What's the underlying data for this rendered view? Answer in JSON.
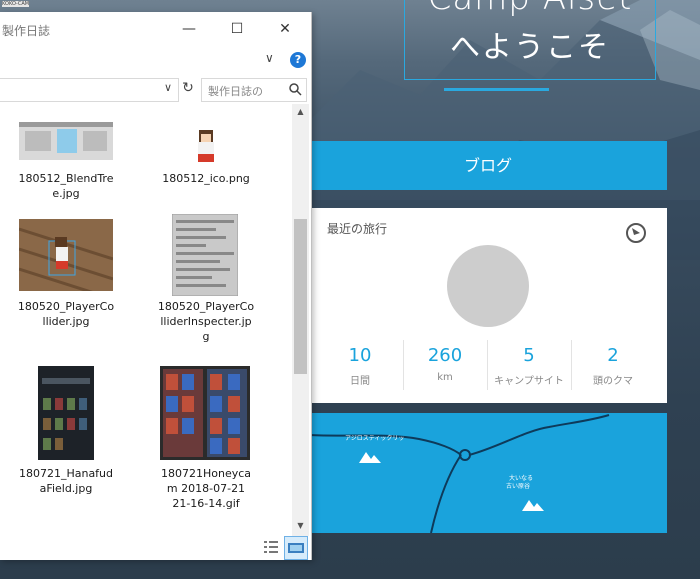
{
  "colors": {
    "accent": "#1aa3dc",
    "explorer_bg": "#ffffff",
    "hero_border": "#2aa9e0"
  },
  "corner_tag": "KOKO-CAM",
  "explorer": {
    "title": "製作日誌",
    "controls": {
      "minimize": "—",
      "maximize": "☐",
      "close": "✕"
    },
    "ribbon": {
      "chevron": "∨",
      "help": "?"
    },
    "address": {
      "dropdown": "∨",
      "refresh": "↻"
    },
    "search": {
      "placeholder": "製作日誌の"
    },
    "files": [
      {
        "name_line1": "180512_BlendTre",
        "name_line2": "e.jpg",
        "name_line3": ""
      },
      {
        "name_line1": "180512_ico.png",
        "name_line2": "",
        "name_line3": ""
      },
      {
        "name_line1": "180520_PlayerCo",
        "name_line2": "llider.jpg",
        "name_line3": ""
      },
      {
        "name_line1": "180520_PlayerCo",
        "name_line2": "lliderInspecter.jp",
        "name_line3": "g"
      },
      {
        "name_line1": "180721_Hanafud",
        "name_line2": "aField.jpg",
        "name_line3": ""
      },
      {
        "name_line1": "180721Honeyca",
        "name_line2": "m 2018-07-21",
        "name_line3": "21-16-14.gif"
      }
    ],
    "scroll": {
      "up": "▲",
      "down": "▼"
    },
    "view_icons": [
      "details-view-icon",
      "large-icons-view-icon"
    ]
  },
  "camp": {
    "hero_line1": "Camp Alset",
    "hero_line2": "へようこそ",
    "blog_button": "ブログ",
    "recent_trips": {
      "title": "最近の旅行",
      "stats": [
        {
          "value": "10",
          "label": "日間"
        },
        {
          "value": "260",
          "label": "km"
        },
        {
          "value": "5",
          "label": "キャンプサイト"
        },
        {
          "value": "2",
          "label": "頭のクマ"
        }
      ]
    },
    "map": {
      "label_left": "アジロスティックリッ",
      "label_right_line1": "大いなる",
      "label_right_line2": "古い原谷"
    }
  }
}
